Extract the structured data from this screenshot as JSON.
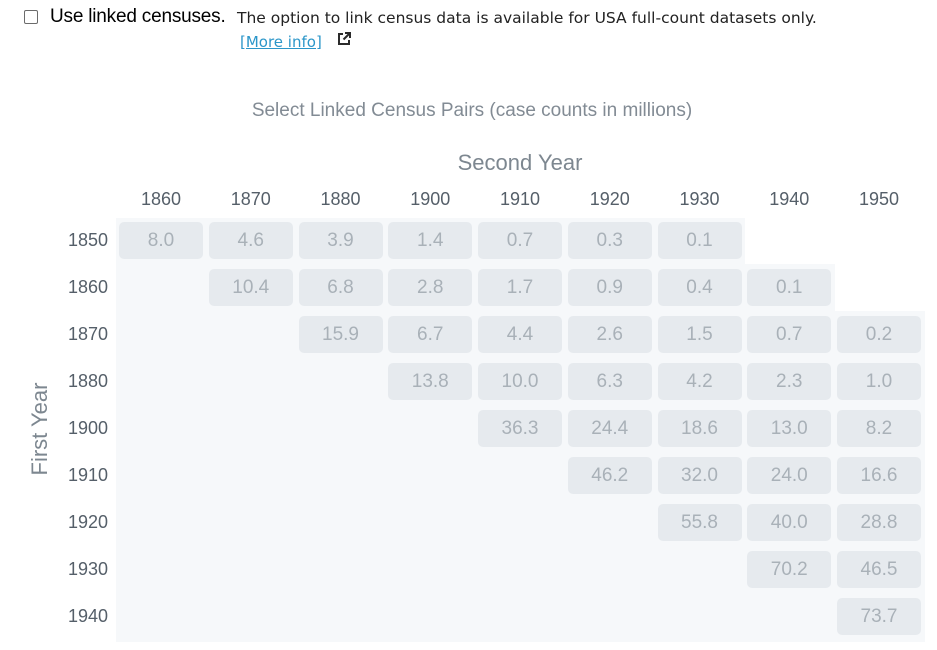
{
  "linked_census": {
    "checkbox_label": "Use linked censuses.",
    "description": "The option to link census data is available for USA full-count datasets only.",
    "more_info": "[More info]",
    "checked": false
  },
  "grid": {
    "title": "Select Linked Census Pairs (case counts in millions)",
    "second_year_label": "Second Year",
    "first_year_label": "First Year",
    "columns": [
      "1860",
      "1870",
      "1880",
      "1900",
      "1910",
      "1920",
      "1930",
      "1940",
      "1950"
    ],
    "rows": [
      {
        "year": "1850",
        "cells": [
          "8.0",
          "4.6",
          "3.9",
          "1.4",
          "0.7",
          "0.3",
          "0.1",
          "",
          ""
        ]
      },
      {
        "year": "1860",
        "cells": [
          "",
          "10.4",
          "6.8",
          "2.8",
          "1.7",
          "0.9",
          "0.4",
          "0.1",
          ""
        ]
      },
      {
        "year": "1870",
        "cells": [
          "",
          "",
          "15.9",
          "6.7",
          "4.4",
          "2.6",
          "1.5",
          "0.7",
          "0.2"
        ]
      },
      {
        "year": "1880",
        "cells": [
          "",
          "",
          "",
          "13.8",
          "10.0",
          "6.3",
          "4.2",
          "2.3",
          "1.0"
        ]
      },
      {
        "year": "1900",
        "cells": [
          "",
          "",
          "",
          "",
          "36.3",
          "24.4",
          "18.6",
          "13.0",
          "8.2"
        ]
      },
      {
        "year": "1910",
        "cells": [
          "",
          "",
          "",
          "",
          "",
          "46.2",
          "32.0",
          "24.0",
          "16.6"
        ]
      },
      {
        "year": "1920",
        "cells": [
          "",
          "",
          "",
          "",
          "",
          "",
          "55.8",
          "40.0",
          "28.8"
        ]
      },
      {
        "year": "1930",
        "cells": [
          "",
          "",
          "",
          "",
          "",
          "",
          "",
          "70.2",
          "46.5"
        ]
      },
      {
        "year": "1940",
        "cells": [
          "",
          "",
          "",
          "",
          "",
          "",
          "",
          "",
          "73.7"
        ]
      }
    ]
  },
  "icons": {
    "more_info_link": "external-link-icon"
  },
  "colors": {
    "cell_bg": "#e6eaee",
    "cell_text": "#a9b1b8",
    "grid_bg": "#f6f8fa",
    "link": "#2b96c9",
    "header_text": "#555f69",
    "title_text": "#828b94"
  }
}
